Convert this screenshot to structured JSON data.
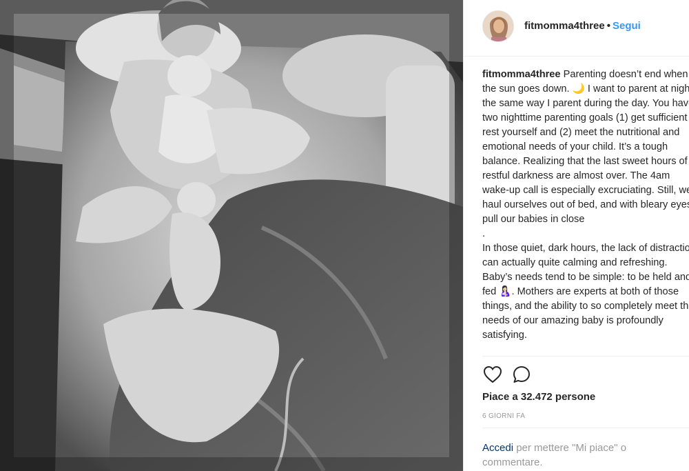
{
  "post": {
    "username": "fitmomma4three",
    "separator": "•",
    "follow_label": "Segui",
    "photo_alt": "Night-vision photo of a mother in bed with her sleeping children",
    "caption": {
      "author": "fitmomma4three",
      "paragraph1": " Parenting doesn’t end when the sun goes down. 🌙 I want to parent at night the same way I parent during the day. You have two nighttime parenting goals (1) get sufficient rest yourself and (2) meet the nutritional and emotional needs of your child. It’s a tough balance. Realizing that the last sweet hours of restful darkness are almost over. The 4am wake-up call is especially excruciating. Still, we haul ourselves out of bed, and with bleary eyes pull our babies in close",
      "dot_line": ".",
      "paragraph2": "In those quiet, dark hours, the lack of distraction can actually quite calming and refreshing.  Baby’s needs tend to be simple: to be held and fed 🤱🏻. Mothers are experts at both of those things, and the ability to so completely meet the needs of our amazing baby is profoundly satisfying."
    },
    "actions": {
      "like_icon": "heart-icon",
      "comment_icon": "comment-icon"
    },
    "likes_text": "Piace a 32.472 persone",
    "time_text": "6 GIORNI FA",
    "login_prompt": {
      "link_text": "Accedi",
      "rest_text": " per mettere \"Mi piace\" o commentare."
    }
  },
  "colors": {
    "accent": "#3897f0",
    "link_dark": "#003569",
    "text": "#262626",
    "muted": "#999999",
    "border": "#efefef"
  }
}
